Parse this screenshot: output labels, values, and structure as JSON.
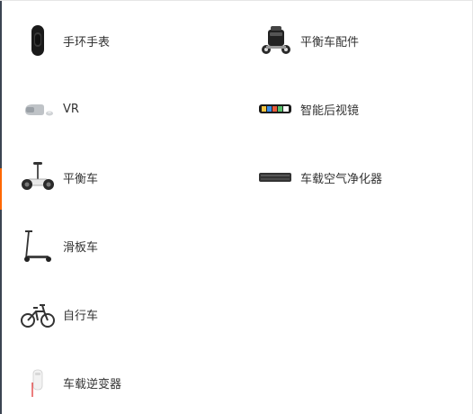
{
  "colors": {
    "accent": "#ff6700",
    "text": "#333333",
    "edge": "#3b4452"
  },
  "items_left": [
    {
      "label": "手环手表",
      "icon": "smart-band-icon"
    },
    {
      "label": "VR",
      "icon": "vr-headset-icon"
    },
    {
      "label": "平衡车",
      "icon": "self-balancing-scooter-icon"
    },
    {
      "label": "滑板车",
      "icon": "kick-scooter-icon"
    },
    {
      "label": "自行车",
      "icon": "folding-bike-icon"
    },
    {
      "label": "车载逆变器",
      "icon": "car-inverter-icon"
    }
  ],
  "items_right": [
    {
      "label": "平衡车配件",
      "icon": "balance-scooter-accessory-icon"
    },
    {
      "label": "智能后视镜",
      "icon": "smart-rearview-mirror-icon"
    },
    {
      "label": "车载空气净化器",
      "icon": "car-air-purifier-icon"
    }
  ]
}
